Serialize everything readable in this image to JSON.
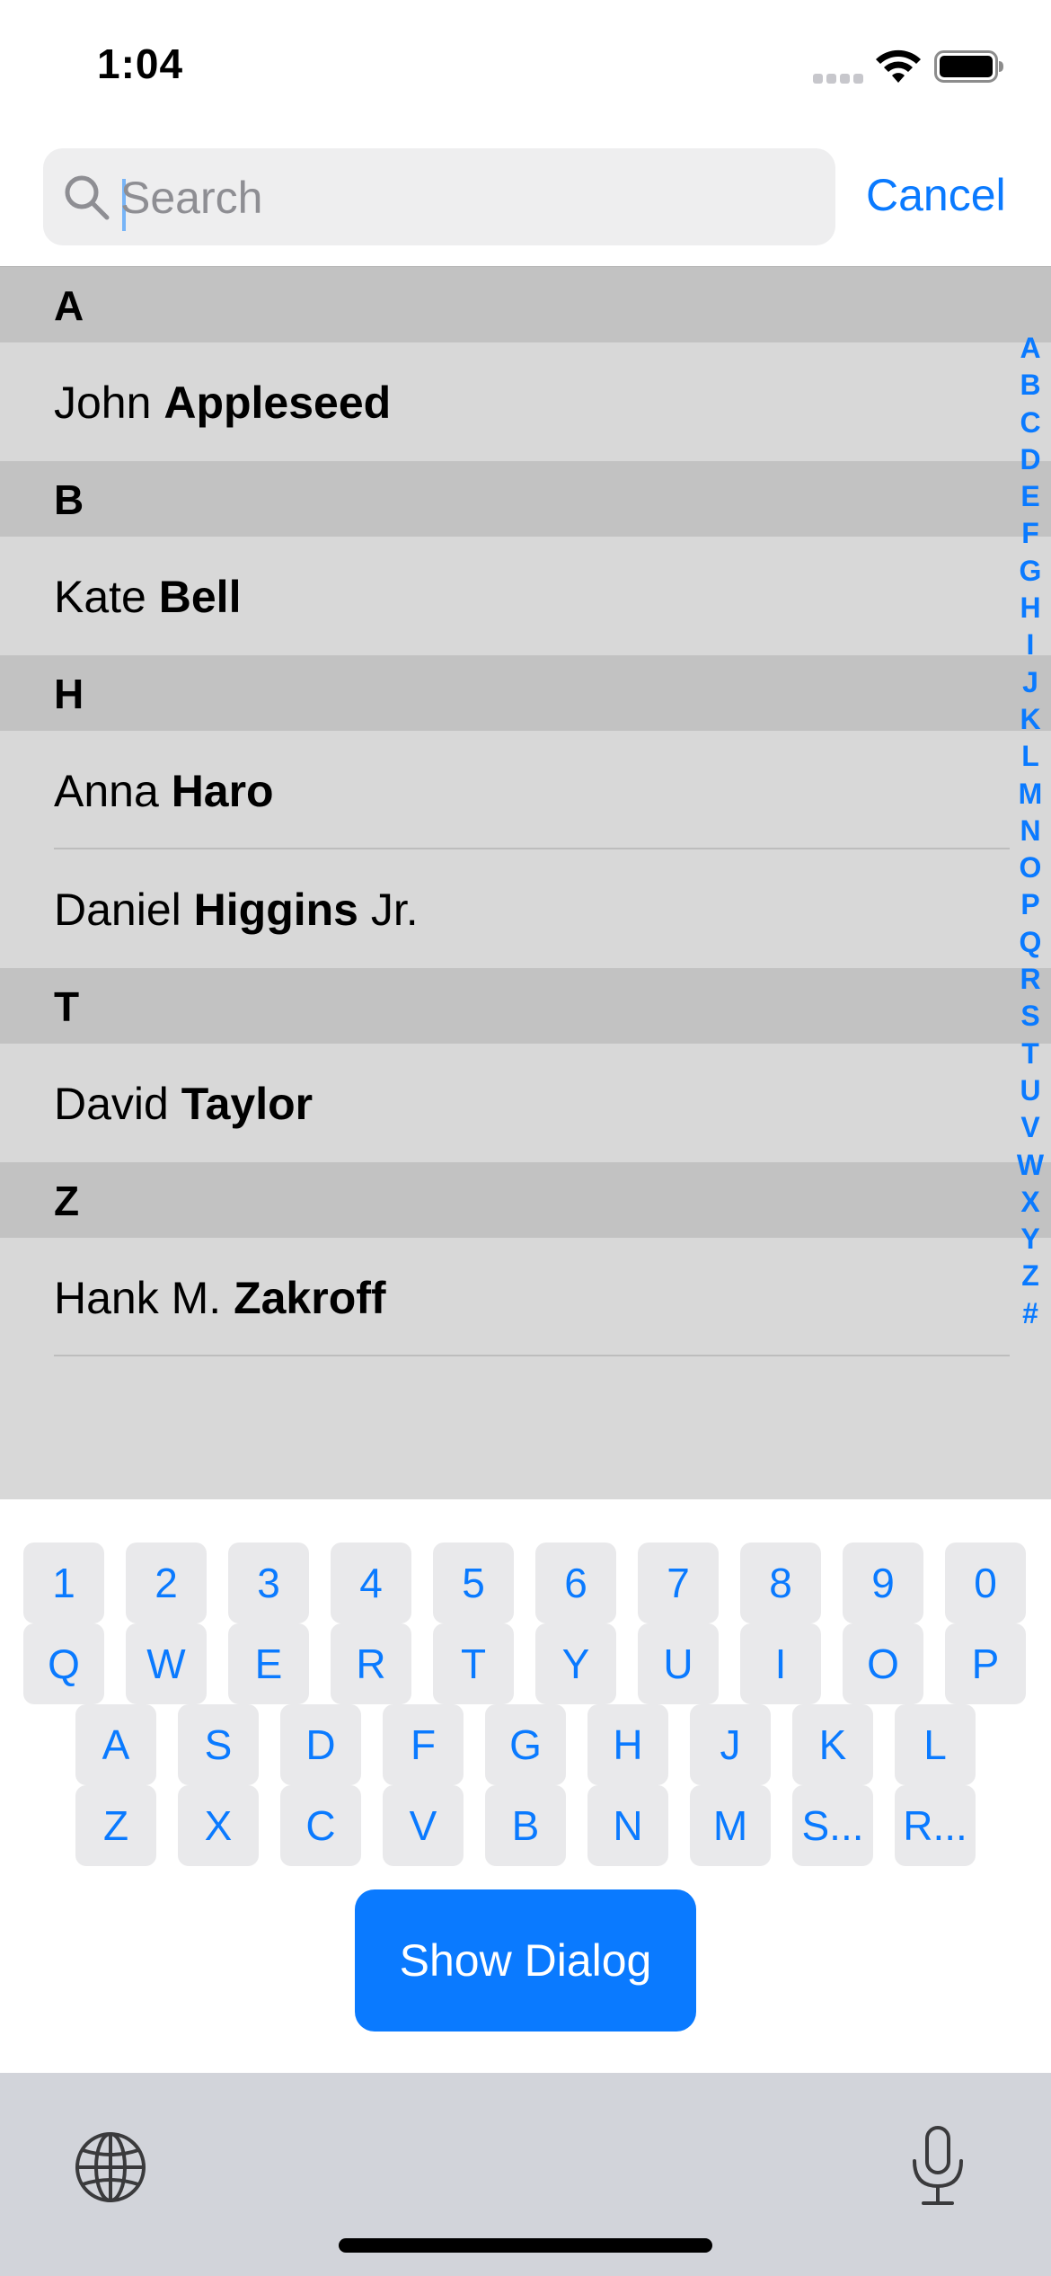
{
  "status_bar": {
    "time": "1:04"
  },
  "search": {
    "placeholder": "Search",
    "value": "",
    "cancel_label": "Cancel"
  },
  "sections": [
    {
      "letter": "A",
      "rows": [
        {
          "first": "John",
          "last": "Appleseed",
          "suffix": ""
        }
      ]
    },
    {
      "letter": "B",
      "rows": [
        {
          "first": "Kate",
          "last": "Bell",
          "suffix": ""
        }
      ]
    },
    {
      "letter": "H",
      "rows": [
        {
          "first": "Anna",
          "last": "Haro",
          "suffix": ""
        },
        {
          "first": "Daniel",
          "last": "Higgins",
          "suffix": "Jr."
        }
      ]
    },
    {
      "letter": "T",
      "rows": [
        {
          "first": "David",
          "last": "Taylor",
          "suffix": ""
        }
      ]
    },
    {
      "letter": "Z",
      "rows": [
        {
          "first": "Hank M.",
          "last": "Zakroff",
          "suffix": ""
        }
      ]
    }
  ],
  "index_letters": [
    "A",
    "B",
    "C",
    "D",
    "E",
    "F",
    "G",
    "H",
    "I",
    "J",
    "K",
    "L",
    "M",
    "N",
    "O",
    "P",
    "Q",
    "R",
    "S",
    "T",
    "U",
    "V",
    "W",
    "X",
    "Y",
    "Z",
    "#"
  ],
  "keyboard": {
    "rows": [
      [
        "1",
        "2",
        "3",
        "4",
        "5",
        "6",
        "7",
        "8",
        "9",
        "0"
      ],
      [
        "Q",
        "W",
        "E",
        "R",
        "T",
        "Y",
        "U",
        "I",
        "O",
        "P"
      ],
      [
        "A",
        "S",
        "D",
        "F",
        "G",
        "H",
        "J",
        "K",
        "L"
      ],
      [
        "Z",
        "X",
        "C",
        "V",
        "B",
        "N",
        "M",
        "S...",
        "R..."
      ]
    ],
    "show_dialog_label": "Show Dialog"
  },
  "colors": {
    "accent": "#0a7aff",
    "list_background": "#d8d8d8",
    "section_header_background": "#c2c2c2",
    "keyboard_bottom_bar": "#d2d4da"
  },
  "icons": {
    "search": "search-icon",
    "wifi": "wifi-icon",
    "battery": "battery-icon",
    "globe": "globe-icon",
    "microphone": "microphone-icon"
  }
}
